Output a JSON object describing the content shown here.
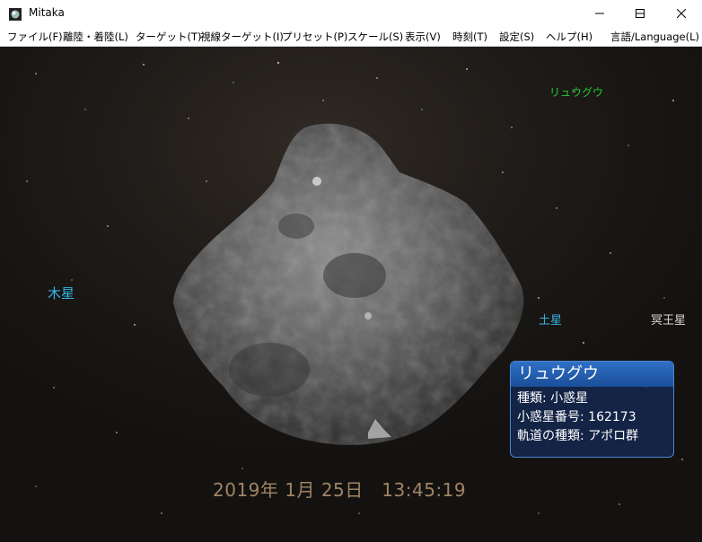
{
  "window": {
    "title": "Mitaka",
    "controls": {
      "minimize_icon": "minimize-icon",
      "maximize_icon": "maximize-icon",
      "close_icon": "close-icon"
    }
  },
  "menu": [
    {
      "label": "ファイル(F)"
    },
    {
      "label": "離陸・着陸(L)"
    },
    {
      "label": "ターゲット(T)"
    },
    {
      "label": "視線ターゲット(I)"
    },
    {
      "label": "プリセット(P)"
    },
    {
      "label": "スケール(S)"
    },
    {
      "label": "表示(V)"
    },
    {
      "label": "時刻(T)"
    },
    {
      "label": "設定(S)"
    },
    {
      "label": "ヘルプ(H)"
    },
    {
      "label": "言語/Language(L)"
    }
  ],
  "labels": {
    "ryugu": "リュウグウ",
    "jupiter": "木星",
    "saturn": "土星",
    "pluto": "冥王星"
  },
  "info_panel": {
    "title": "リュウグウ",
    "type_line": "種類: 小惑星",
    "number_line": "小惑星番号: 162173",
    "orbit_line": "軌道の種類: アポロ群"
  },
  "datetime": "2019年 1月 25日　13:45:19",
  "colors": {
    "ryugu_label": "#22cc33",
    "planet_label": "#35b4e6",
    "pluto_label": "#d8d8d8",
    "panel_accent": "#2e6fc5",
    "datetime": "#a08464"
  }
}
